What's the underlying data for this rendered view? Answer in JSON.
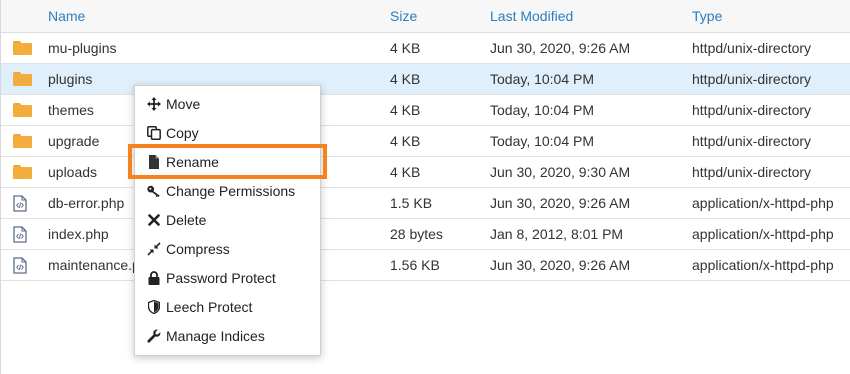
{
  "columns": {
    "name": "Name",
    "size": "Size",
    "modified": "Last Modified",
    "type": "Type"
  },
  "rows": [
    {
      "name": "mu-plugins",
      "size": "4 KB",
      "modified": "Jun 30, 2020, 9:26 AM",
      "type": "httpd/unix-directory",
      "icon": "folder-icon"
    },
    {
      "name": "plugins",
      "size": "4 KB",
      "modified": "Today, 10:04 PM",
      "type": "httpd/unix-directory",
      "icon": "folder-icon",
      "selected": true
    },
    {
      "name": "themes",
      "size": "4 KB",
      "modified": "Today, 10:04 PM",
      "type": "httpd/unix-directory",
      "icon": "folder-icon"
    },
    {
      "name": "upgrade",
      "size": "4 KB",
      "modified": "Today, 10:04 PM",
      "type": "httpd/unix-directory",
      "icon": "folder-icon"
    },
    {
      "name": "uploads",
      "size": "4 KB",
      "modified": "Jun 30, 2020, 9:30 AM",
      "type": "httpd/unix-directory",
      "icon": "folder-icon"
    },
    {
      "name": "db-error.php",
      "size": "1.5 KB",
      "modified": "Jun 30, 2020, 9:26 AM",
      "type": "application/x-httpd-php",
      "icon": "php-file-icon"
    },
    {
      "name": "index.php",
      "size": "28 bytes",
      "modified": "Jan 8, 2012, 8:01 PM",
      "type": "application/x-httpd-php",
      "icon": "php-file-icon"
    },
    {
      "name": "maintenance.p",
      "size": "1.56 KB",
      "modified": "Jun 30, 2020, 9:26 AM",
      "type": "application/x-httpd-php",
      "icon": "php-file-icon"
    }
  ],
  "context_menu": {
    "items": [
      {
        "label": "Move",
        "icon": "move-icon"
      },
      {
        "label": "Copy",
        "icon": "copy-icon"
      },
      {
        "label": "Rename",
        "icon": "file-icon",
        "highlighted": true
      },
      {
        "label": "Change Permissions",
        "icon": "key-icon"
      },
      {
        "label": "Delete",
        "icon": "x-icon"
      },
      {
        "label": "Compress",
        "icon": "compress-icon"
      },
      {
        "label": "Password Protect",
        "icon": "lock-icon"
      },
      {
        "label": "Leech Protect",
        "icon": "shield-icon"
      },
      {
        "label": "Manage Indices",
        "icon": "wrench-icon"
      }
    ]
  },
  "colors": {
    "header_text": "#2b7ec1",
    "selected_row": "#dfeffb",
    "folder": "#f2ad3c",
    "highlight_outline": "#f5821f"
  }
}
